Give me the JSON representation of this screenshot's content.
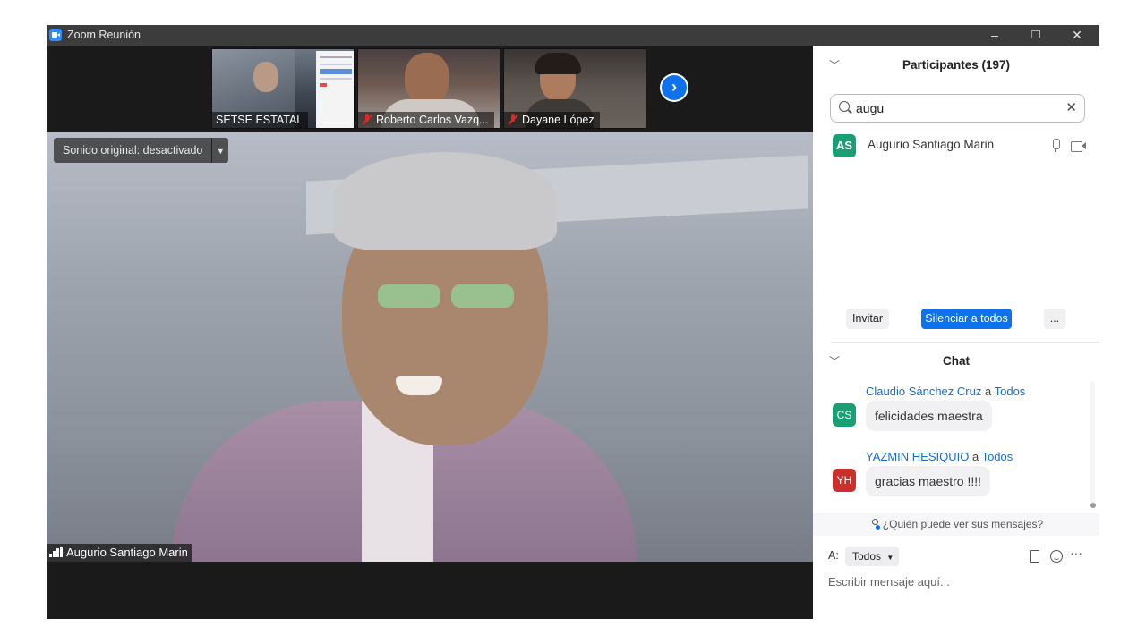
{
  "window": {
    "title": "Zoom Reunión",
    "minimize": "–",
    "restore": "❐",
    "close": "✕"
  },
  "thumbnails": [
    {
      "name": "SETSE ESTATAL",
      "muted": false
    },
    {
      "name": "Roberto Carlos Vazq...",
      "muted": true
    },
    {
      "name": "Dayane López",
      "muted": true
    }
  ],
  "next_arrow": "›",
  "main_video": {
    "sound_label": "Sonido original: desactivado",
    "speaker_name": "Augurio Santiago Marin"
  },
  "participants": {
    "title": "Participantes (197)",
    "collapse_icon": "chevron-down-icon",
    "search_value": "augu",
    "clear_icon": "✕",
    "rows": [
      {
        "initials": "AS",
        "name": "Augurio Santiago Marin",
        "avatar_color": "#1a9e76"
      }
    ],
    "invite_label": "Invitar",
    "mute_all_label": "Silenciar a todos",
    "more_label": "..."
  },
  "chat": {
    "title": "Chat",
    "messages": [
      {
        "initials": "CS",
        "sender": "Claudio Sánchez Cruz",
        "to_word": "a",
        "recipient": "Todos",
        "text": "felicidades maestra",
        "avatar_color": "#1a9e76"
      },
      {
        "initials": "YH",
        "sender": "YAZMIN HESIQUIO",
        "to_word": "a",
        "recipient": "Todos",
        "text": "gracias maestro !!!!",
        "avatar_color": "#c9302c"
      }
    ],
    "who_sees": "¿Quién puede ver sus mensajes?",
    "to_label": "A:",
    "to_value": "Todos",
    "more_label": "···",
    "input_placeholder": "Escribir mensaje aquí..."
  },
  "colors": {
    "accent": "#0e72ed",
    "titlebar": "#3c3c3c",
    "video_bg": "#1a1a1a"
  }
}
